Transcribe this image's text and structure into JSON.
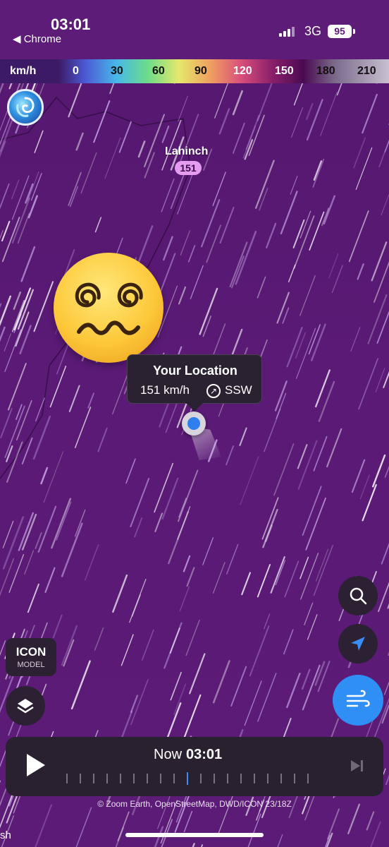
{
  "status_bar": {
    "time": "03:01",
    "back_app": "◀ Chrome",
    "network": "3G",
    "battery": "95"
  },
  "legend": {
    "unit": "km/h",
    "ticks": [
      "0",
      "30",
      "60",
      "90",
      "120",
      "150",
      "180",
      "210"
    ]
  },
  "map": {
    "place_name": "Lahinch",
    "place_value": "151",
    "tooltip": {
      "title": "Your Location",
      "speed": "151 km/h",
      "direction": "SSW"
    }
  },
  "controls": {
    "model_name": "ICON",
    "model_sub": "MODEL"
  },
  "timeline": {
    "now_label": "Now",
    "now_time": "03:01"
  },
  "credits": "© Zoom Earth, OpenStreetMap, DWD/ICON 23/18Z",
  "edge_text": "sh",
  "colors": {
    "map_purple": "#5a1a74",
    "panel_dark": "#2a2130",
    "accent_blue": "#2f8ff5"
  }
}
